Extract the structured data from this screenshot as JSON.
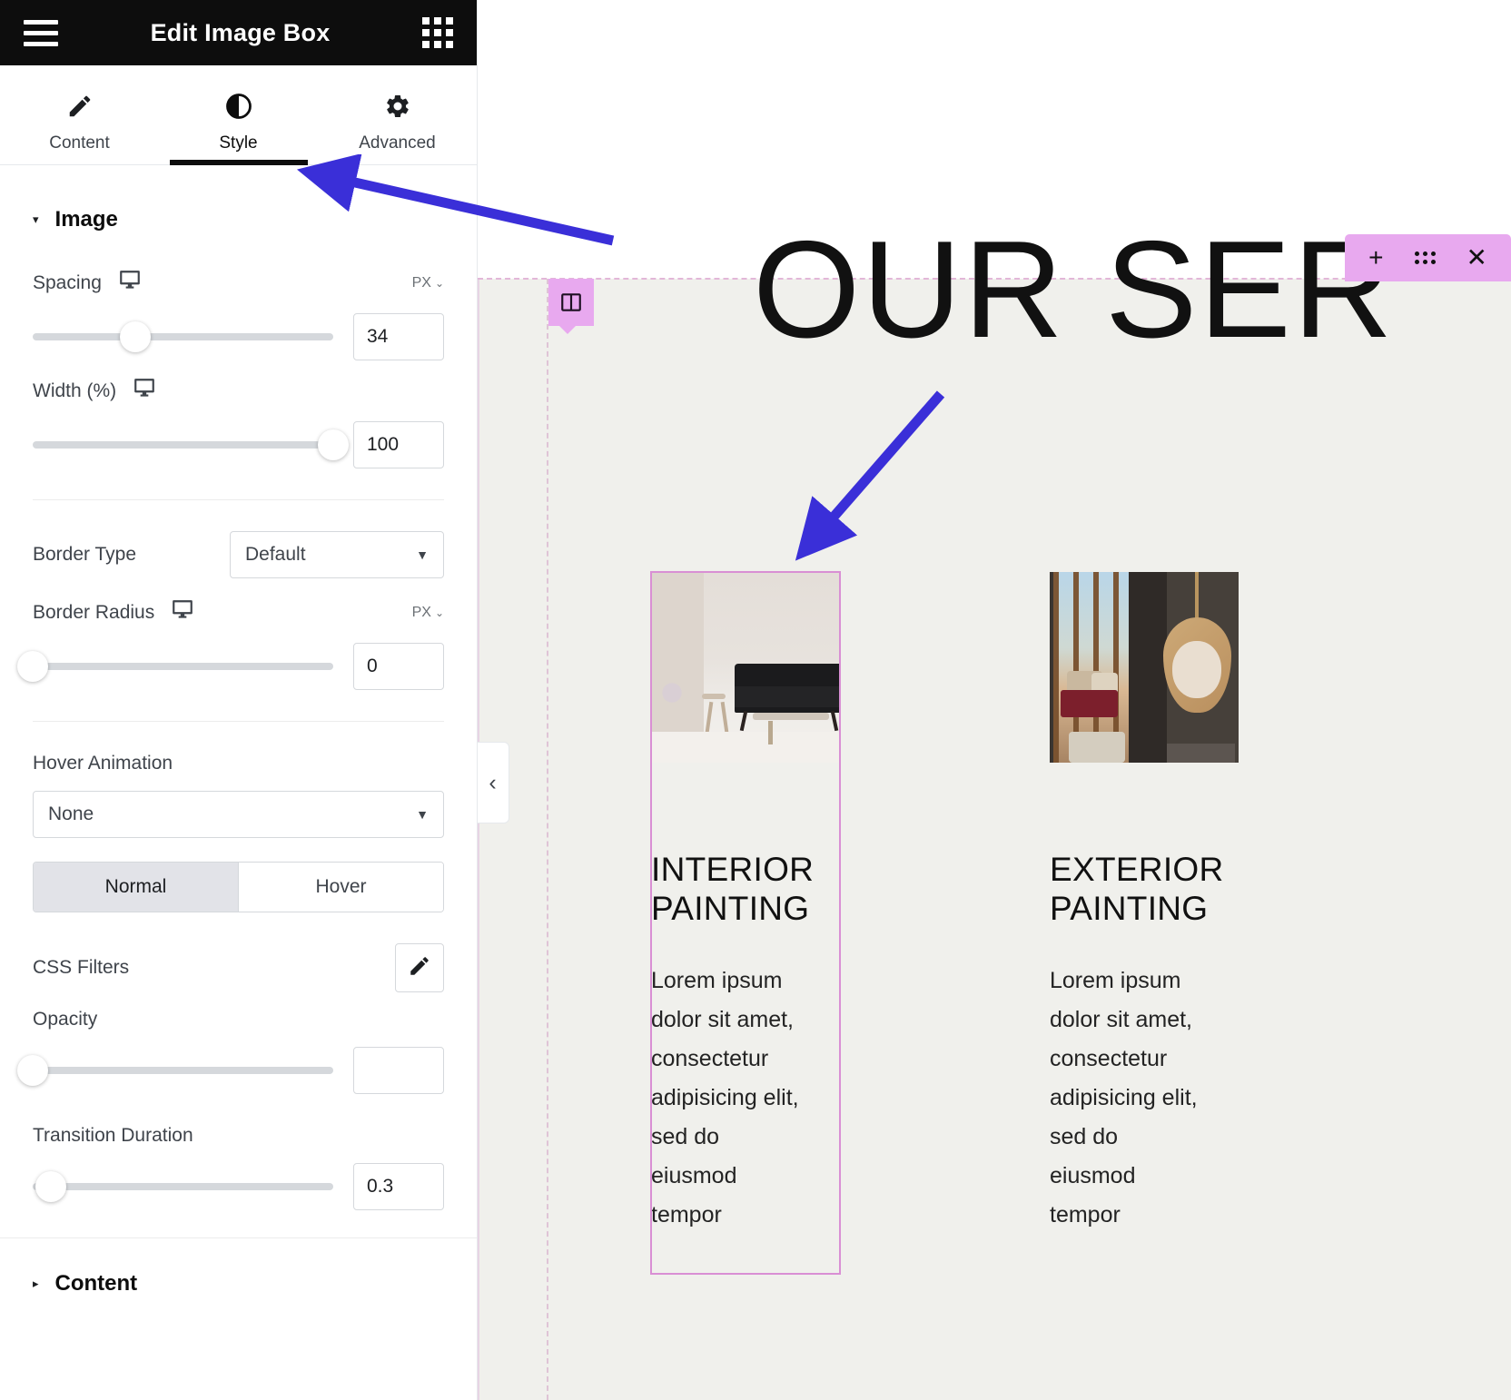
{
  "panel": {
    "title": "Edit Image Box",
    "menu_icon": "hamburger-icon",
    "grid_icon": "apps-grid-icon",
    "tabs": [
      {
        "label": "Content",
        "icon": "pencil-icon",
        "active": false
      },
      {
        "label": "Style",
        "icon": "contrast-half-circle-icon",
        "active": true
      },
      {
        "label": "Advanced",
        "icon": "gear-icon",
        "active": false
      }
    ],
    "image_section": {
      "title": "Image",
      "caret": "▾",
      "spacing": {
        "label": "Spacing",
        "device_icon": "desktop-icon",
        "unit": "PX",
        "unit_chevron": "⌄",
        "value": "34",
        "slider_percent": 34
      },
      "width": {
        "label": "Width (%)",
        "device_icon": "desktop-icon",
        "value": "100",
        "slider_percent": 100
      },
      "border_type": {
        "label": "Border Type",
        "value": "Default",
        "arrow": "▼"
      },
      "border_radius": {
        "label": "Border Radius",
        "device_icon": "desktop-icon",
        "unit": "PX",
        "unit_chevron": "⌄",
        "value": "0",
        "slider_percent": 0
      },
      "hover_animation": {
        "label": "Hover Animation",
        "value": "None",
        "arrow": "▼"
      },
      "state_tabs": [
        {
          "label": "Normal",
          "active": true
        },
        {
          "label": "Hover",
          "active": false
        }
      ],
      "css_filters": {
        "label": "CSS Filters",
        "edit_icon": "pencil-icon"
      },
      "opacity": {
        "label": "Opacity",
        "value": "",
        "slider_percent": 0
      },
      "transition_duration": {
        "label": "Transition Duration",
        "value": "0.3",
        "slider_percent": 6
      }
    },
    "content_section": {
      "title": "Content",
      "caret": "▸"
    },
    "collapse_handle": "‹"
  },
  "canvas": {
    "hero_title": "OUR SER",
    "section_toolbar": {
      "add": "+",
      "drag": "drag-dots-icon",
      "close": "✕"
    },
    "column_handle_icon": "column-layout-icon",
    "cards": [
      {
        "title": "INTERIOR\nPAINTING",
        "text": "Lorem ipsum\ndolor sit amet,\nconsectetur\nadipisicing elit,\nsed do\neiusmod\ntempor",
        "image_alt": "light-living-room-black-sofa",
        "selected": true
      },
      {
        "title": "EXTERIOR\nPAINTING",
        "text": "Lorem ipsum\ndolor sit amet,\nconsectetur\nadipisicing elit,\nsed do\neiusmod\ntempor",
        "image_alt": "dark-room-rattan-hanging-chair",
        "selected": false
      }
    ]
  },
  "colors": {
    "header_bg": "#0d0d0d",
    "accent_pink": "#e8a9ef",
    "selection_border": "#d98fd4",
    "canvas_section_bg": "#f0f0ec",
    "annotation_arrow": "#3a2fd8"
  }
}
